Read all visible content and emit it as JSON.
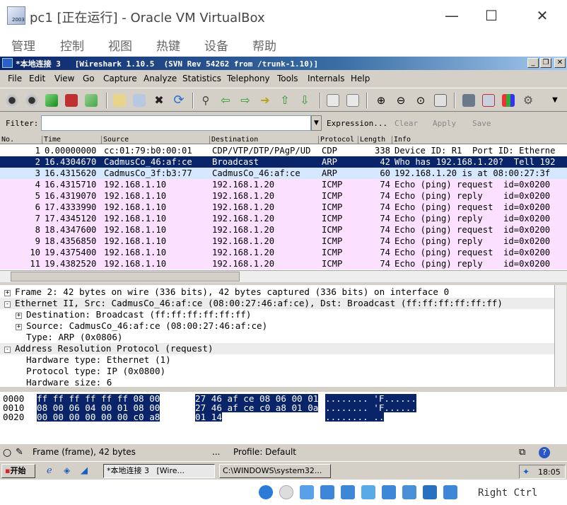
{
  "host": {
    "title": "pc1 [正在运行] - Oracle VM VirtualBox",
    "menu": [
      "管理",
      "控制",
      "视图",
      "热键",
      "设备",
      "帮助"
    ],
    "minimize": "—",
    "maximize": "☐",
    "close": "✕",
    "icon_text": "2003"
  },
  "wireshark": {
    "title": "*本地连接 3   [Wireshark 1.10.5  (SVN Rev 54262 from /trunk-1.10)]",
    "menu": [
      "File",
      "Edit",
      "View",
      "Go",
      "Capture",
      "Analyze",
      "Statistics",
      "Telephony",
      "Tools",
      "Internals",
      "Help"
    ],
    "filter_label": "Filter:",
    "filter_value": "",
    "filter_buttons": [
      "Expression...",
      "Clear",
      "Apply",
      "Save"
    ],
    "columns": [
      "No.",
      "Time",
      "Source",
      "Destination",
      "Protocol",
      "Length",
      "Info"
    ],
    "packets": [
      {
        "no": "1",
        "time": "0.00000000",
        "src": "cc:01:79:b0:00:01",
        "dst": "CDP/VTP/DTP/PAgP/UD",
        "proto": "CDP",
        "len": "338",
        "info": "Device ID: R1  Port ID: Etherne"
      },
      {
        "no": "2",
        "time": "16.4304670",
        "src": "CadmusCo_46:af:ce",
        "dst": "Broadcast",
        "proto": "ARP",
        "len": "42",
        "info": "Who has 192.168.1.20?  Tell 192"
      },
      {
        "no": "3",
        "time": "16.4315620",
        "src": "CadmusCo_3f:b3:77",
        "dst": "CadmusCo_46:af:ce",
        "proto": "ARP",
        "len": "60",
        "info": "192.168.1.20 is at 08:00:27:3f"
      },
      {
        "no": "4",
        "time": "16.4315710",
        "src": "192.168.1.10",
        "dst": "192.168.1.20",
        "proto": "ICMP",
        "len": "74",
        "info": "Echo (ping) request  id=0x0200"
      },
      {
        "no": "5",
        "time": "16.4319070",
        "src": "192.168.1.10",
        "dst": "192.168.1.20",
        "proto": "ICMP",
        "len": "74",
        "info": "Echo (ping) reply    id=0x0200"
      },
      {
        "no": "6",
        "time": "17.4333990",
        "src": "192.168.1.10",
        "dst": "192.168.1.20",
        "proto": "ICMP",
        "len": "74",
        "info": "Echo (ping) request  id=0x0200"
      },
      {
        "no": "7",
        "time": "17.4345120",
        "src": "192.168.1.10",
        "dst": "192.168.1.20",
        "proto": "ICMP",
        "len": "74",
        "info": "Echo (ping) reply    id=0x0200"
      },
      {
        "no": "8",
        "time": "18.4347600",
        "src": "192.168.1.10",
        "dst": "192.168.1.20",
        "proto": "ICMP",
        "len": "74",
        "info": "Echo (ping) request  id=0x0200"
      },
      {
        "no": "9",
        "time": "18.4356850",
        "src": "192.168.1.10",
        "dst": "192.168.1.20",
        "proto": "ICMP",
        "len": "74",
        "info": "Echo (ping) reply    id=0x0200"
      },
      {
        "no": "10",
        "time": "19.4375400",
        "src": "192.168.1.10",
        "dst": "192.168.1.20",
        "proto": "ICMP",
        "len": "74",
        "info": "Echo (ping) request  id=0x0200"
      },
      {
        "no": "11",
        "time": "19.4382520",
        "src": "192.168.1.10",
        "dst": "192.168.1.20",
        "proto": "ICMP",
        "len": "74",
        "info": "Echo (ping) reply    id=0x0200"
      }
    ],
    "row_colors": {
      "cdp": "#ffffff",
      "arp": "#d6e8ff",
      "icmp": "#fce0ff",
      "selected": "#0a246a"
    },
    "details": [
      {
        "exp": "+",
        "indent": 0,
        "text": "Frame 2: 42 bytes on wire (336 bits), 42 bytes captured (336 bits) on interface 0"
      },
      {
        "exp": "-",
        "indent": 0,
        "text": "Ethernet II, Src: CadmusCo_46:af:ce (08:00:27:46:af:ce), Dst: Broadcast (ff:ff:ff:ff:ff:ff)"
      },
      {
        "exp": "+",
        "indent": 1,
        "text": "Destination: Broadcast (ff:ff:ff:ff:ff:ff)"
      },
      {
        "exp": "+",
        "indent": 1,
        "text": "Source: CadmusCo_46:af:ce (08:00:27:46:af:ce)"
      },
      {
        "exp": "",
        "indent": 1,
        "text": "Type: ARP (0x0806)"
      },
      {
        "exp": "-",
        "indent": 0,
        "text": "Address Resolution Protocol (request)"
      },
      {
        "exp": "",
        "indent": 1,
        "text": "Hardware type: Ethernet (1)"
      },
      {
        "exp": "",
        "indent": 1,
        "text": "Protocol type: IP (0x0800)"
      },
      {
        "exp": "",
        "indent": 1,
        "text": "Hardware size: 6"
      }
    ],
    "bytes": [
      {
        "off": "0000",
        "hex1": "ff ff ff ff ff ff 08 00",
        "hex2": "27 46 af ce 08 06 00 01",
        "ascii": "........ 'F......"
      },
      {
        "off": "0010",
        "hex1": "08 00 06 04 00 01 08 00",
        "hex2": "27 46 af ce c0 a8 01 0a",
        "ascii": "........ 'F......"
      },
      {
        "off": "0020",
        "hex1": "00 00 00 00 00 00 c0 a8",
        "hex2": "01 14",
        "ascii": "........ .."
      }
    ],
    "status_frame": "Frame (frame), 42 bytes",
    "status_dots": "...",
    "status_profile": "Profile: Default"
  },
  "taskbar": {
    "start": "开始",
    "tasks": [
      "*本地连接 3   [Wire...",
      "C:\\WINDOWS\\system32..."
    ],
    "clock": "18:05"
  },
  "host_status": {
    "right_ctrl": "Right Ctrl"
  }
}
